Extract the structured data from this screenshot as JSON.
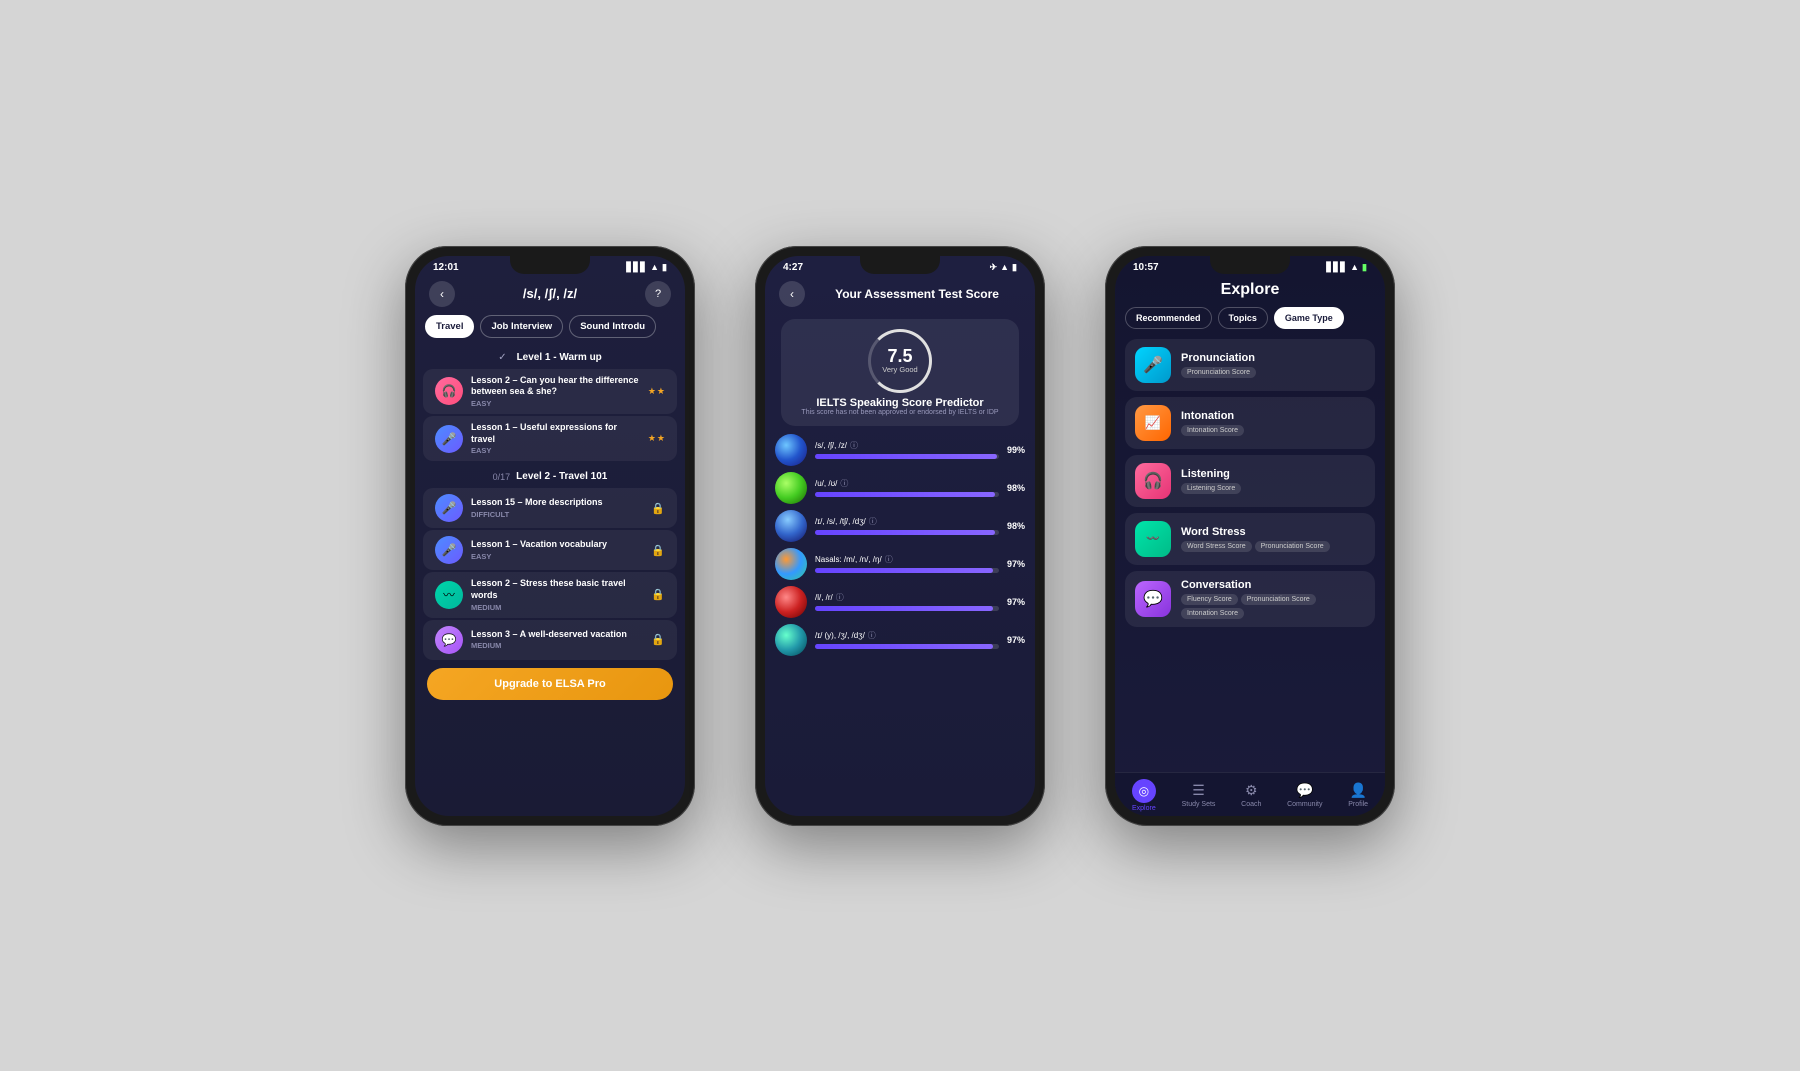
{
  "scene": {
    "background": "#d5d5d5"
  },
  "phone1": {
    "status_time": "12:01",
    "title": "/s/, /ʃ/, /z/",
    "tabs": [
      "Travel",
      "Job Interview",
      "Sound Introdu"
    ],
    "level1": {
      "label": "Level 1 - Warm up"
    },
    "lessons_l1": [
      {
        "name": "Lesson 2 – Can you hear the difference between sea & she?",
        "difficulty": "EASY",
        "icon": "pink",
        "stars": 2
      },
      {
        "name": "Lesson 1 – Useful expressions for travel",
        "difficulty": "EASY",
        "icon": "blue",
        "stars": 2
      }
    ],
    "level2": {
      "count": "0/17",
      "label": "Level 2 - Travel 101"
    },
    "lessons_l2": [
      {
        "name": "Lesson 15 – More descriptions",
        "difficulty": "DIFFICULT",
        "icon": "blue",
        "locked": true
      },
      {
        "name": "Lesson 1 – Vacation vocabulary",
        "difficulty": "EASY",
        "icon": "blue",
        "locked": true
      },
      {
        "name": "Lesson 2 – Stress these basic travel words",
        "difficulty": "MEDIUM",
        "icon": "teal",
        "locked": true
      },
      {
        "name": "Lesson 3 – A well-deserved vacation",
        "difficulty": "MEDIUM",
        "icon": "chat",
        "locked": true
      }
    ],
    "upgrade_btn": "Upgrade to ELSA Pro"
  },
  "phone2": {
    "status_time": "4:27",
    "title": "Your Assessment Test Score",
    "score": "7.5",
    "score_label": "Very Good",
    "ielts_title": "IELTS Speaking Score Predictor",
    "ielts_sub": "This score has not been approved or endorsed by IELTS or IDP",
    "scores": [
      {
        "label": "/s/, /ʃ/, /z/",
        "pct": 99,
        "ball": "blue-swirl"
      },
      {
        "label": "/u/, /ʊ/",
        "pct": 98,
        "ball": "green"
      },
      {
        "label": "/ɪ/, /s/, /tʃ/, /dʒ/",
        "pct": 98,
        "ball": "blue-stripe"
      },
      {
        "label": "Nasals: /m/, /n/, /ŋ/",
        "pct": 97,
        "ball": "multi"
      },
      {
        "label": "/l/, /r/",
        "pct": 97,
        "ball": "red"
      },
      {
        "label": "/ɪ/ (y), /ʒ/, /dʒ/",
        "pct": 97,
        "ball": "teal-swirl"
      }
    ]
  },
  "phone3": {
    "status_time": "10:57",
    "title": "Explore",
    "tabs": [
      "Recommended",
      "Topics",
      "Game Type"
    ],
    "active_tab": "Game Type",
    "categories": [
      {
        "name": "Pronunciation",
        "icon": "cyan",
        "icon_char": "🎤",
        "tags": [
          "Pronunciation Score"
        ]
      },
      {
        "name": "Intonation",
        "icon": "orange",
        "icon_char": "📈",
        "tags": [
          "Intonation Score"
        ]
      },
      {
        "name": "Listening",
        "icon": "pink",
        "icon_char": "🎧",
        "tags": [
          "Listening Score"
        ]
      },
      {
        "name": "Word Stress",
        "icon": "teal",
        "icon_char": "〰",
        "tags": [
          "Word Stress Score",
          "Pronunciation Score"
        ]
      },
      {
        "name": "Conversation",
        "icon": "purple",
        "icon_char": "💬",
        "tags": [
          "Fluency Score",
          "Pronunciation Score",
          "Intonation Score"
        ]
      }
    ],
    "nav": [
      {
        "label": "Explore",
        "active": true
      },
      {
        "label": "Study Sets",
        "active": false
      },
      {
        "label": "Coach",
        "active": false
      },
      {
        "label": "Community",
        "active": false
      },
      {
        "label": "Profile",
        "active": false
      }
    ]
  }
}
